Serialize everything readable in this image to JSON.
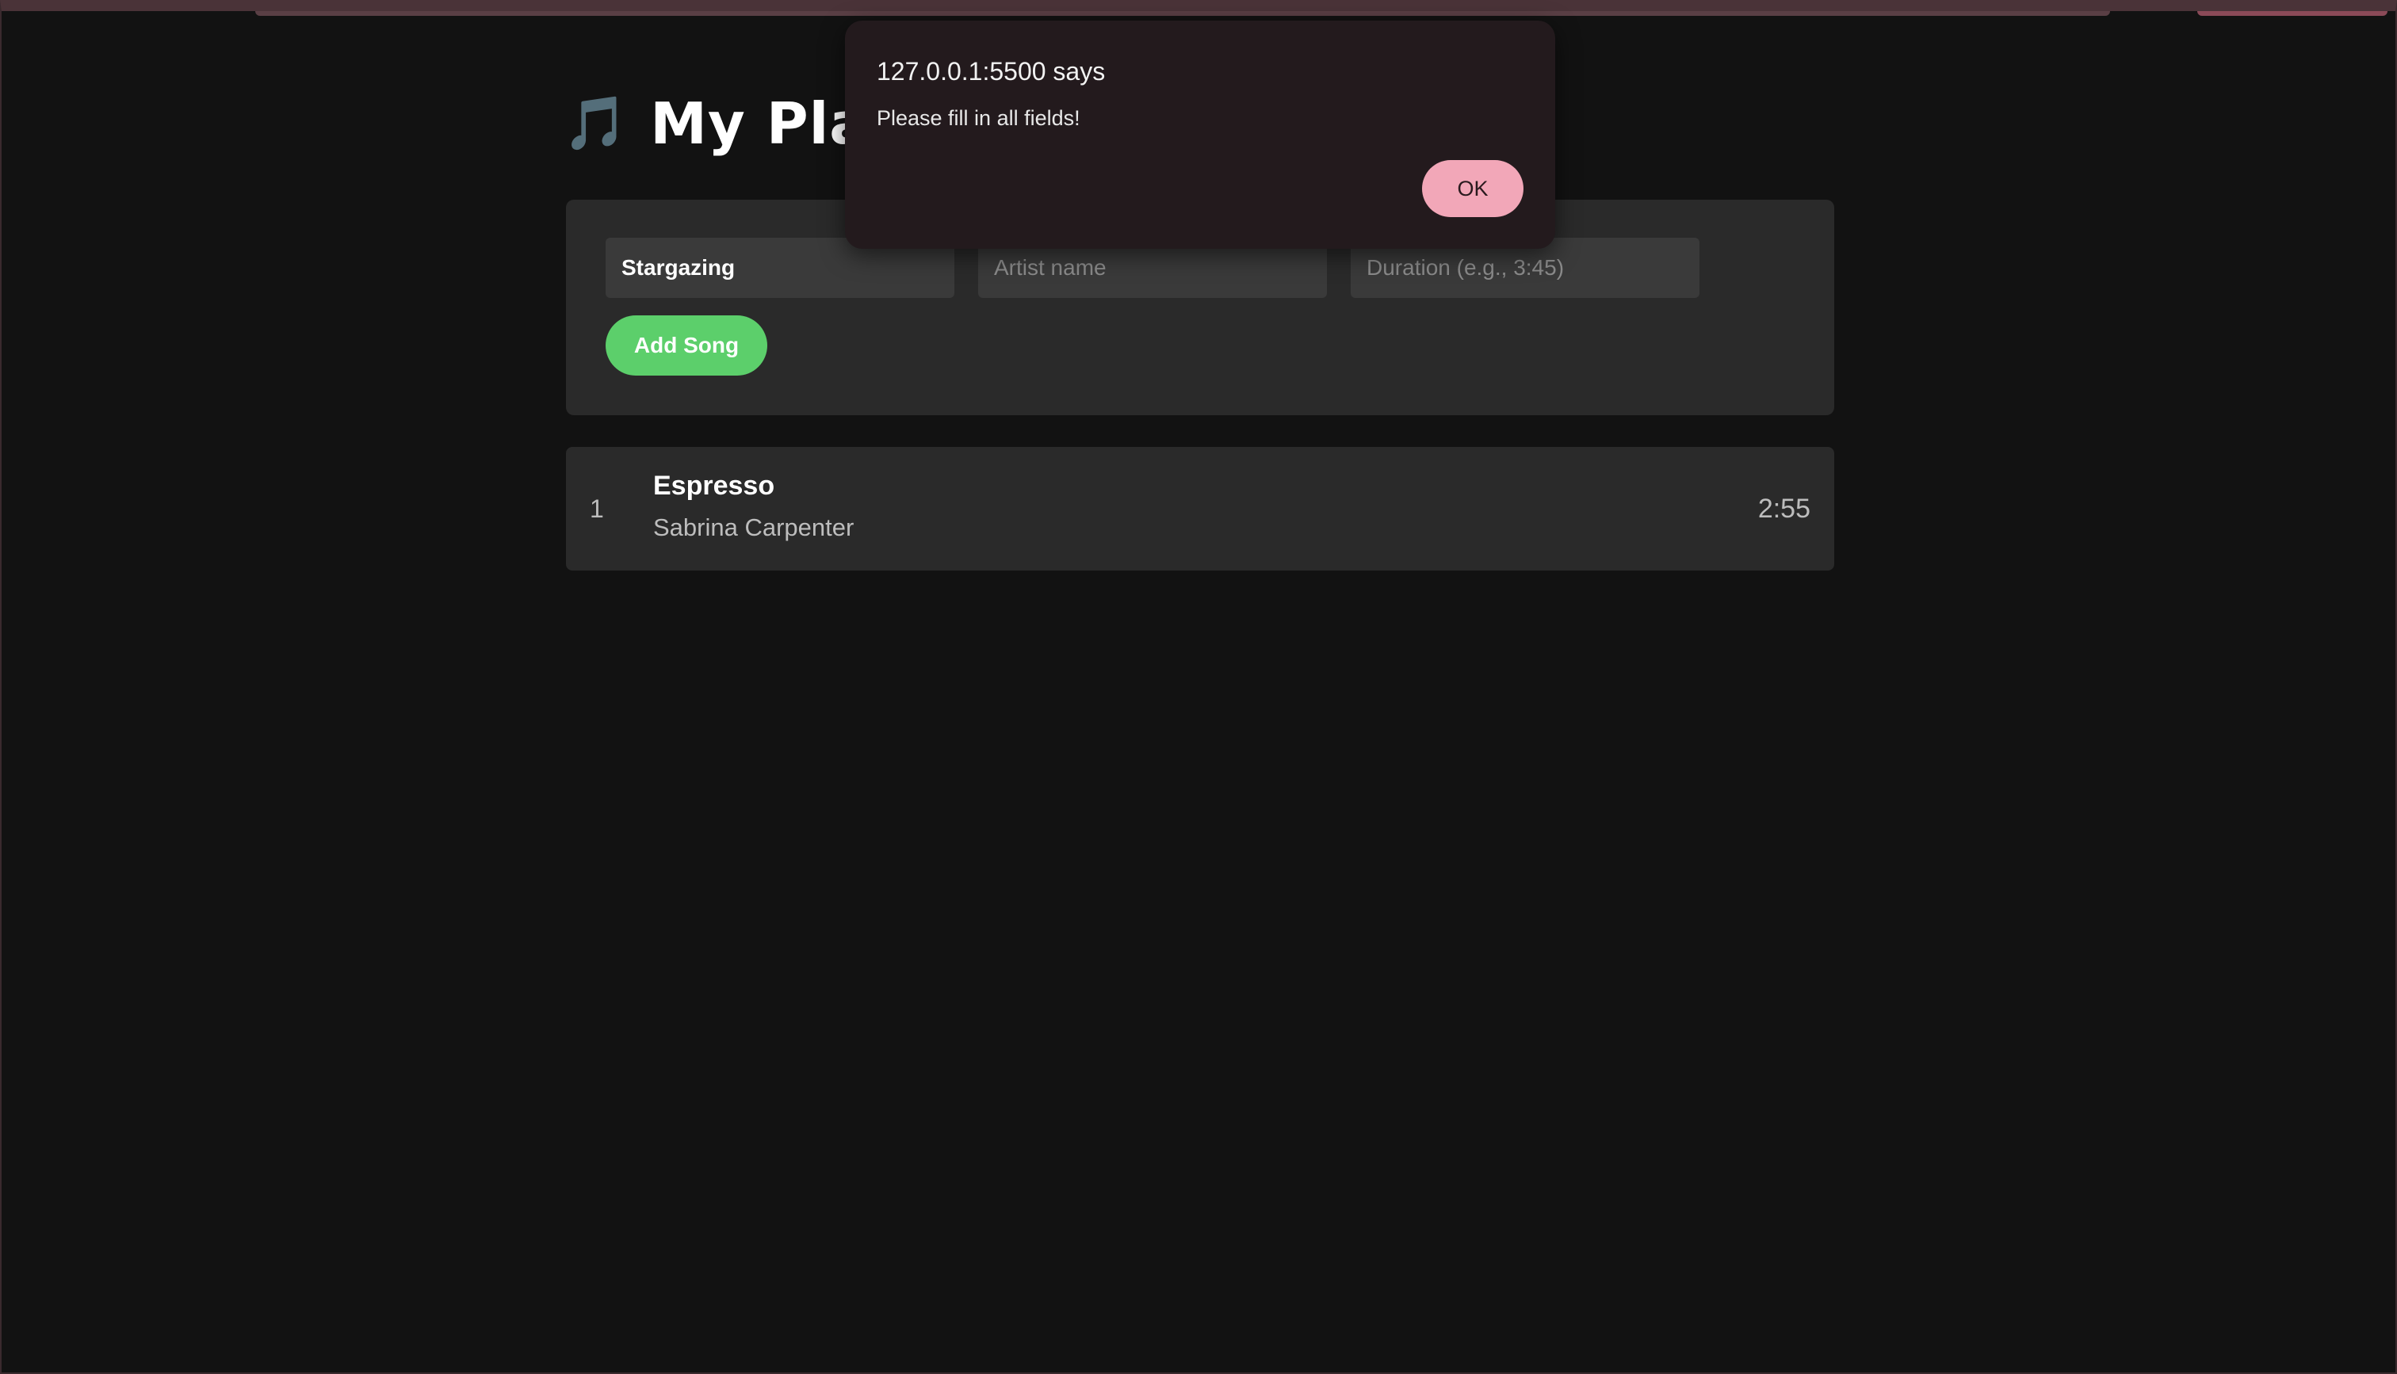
{
  "page": {
    "heading_icon": "🎵",
    "heading_icon_name": "music-note-icon",
    "title_visible": "My Playl"
  },
  "form": {
    "title_value": "Stargazing",
    "artist_placeholder": "Artist name",
    "duration_placeholder": "Duration (e.g., 3:45)",
    "add_button_label": "Add Song"
  },
  "playlist": {
    "songs": [
      {
        "index": "1",
        "title": "Espresso",
        "artist": "Sabrina Carpenter",
        "duration": "2:55"
      }
    ]
  },
  "alert": {
    "title": "127.0.0.1:5500 says",
    "message": "Please fill in all fields!",
    "ok_label": "OK"
  },
  "colors": {
    "background": "#121212",
    "card": "#2a2a2a",
    "accent_green": "#5ccf6b",
    "dialog_bg": "#231a1d",
    "dialog_button": "#f2a7b8"
  }
}
